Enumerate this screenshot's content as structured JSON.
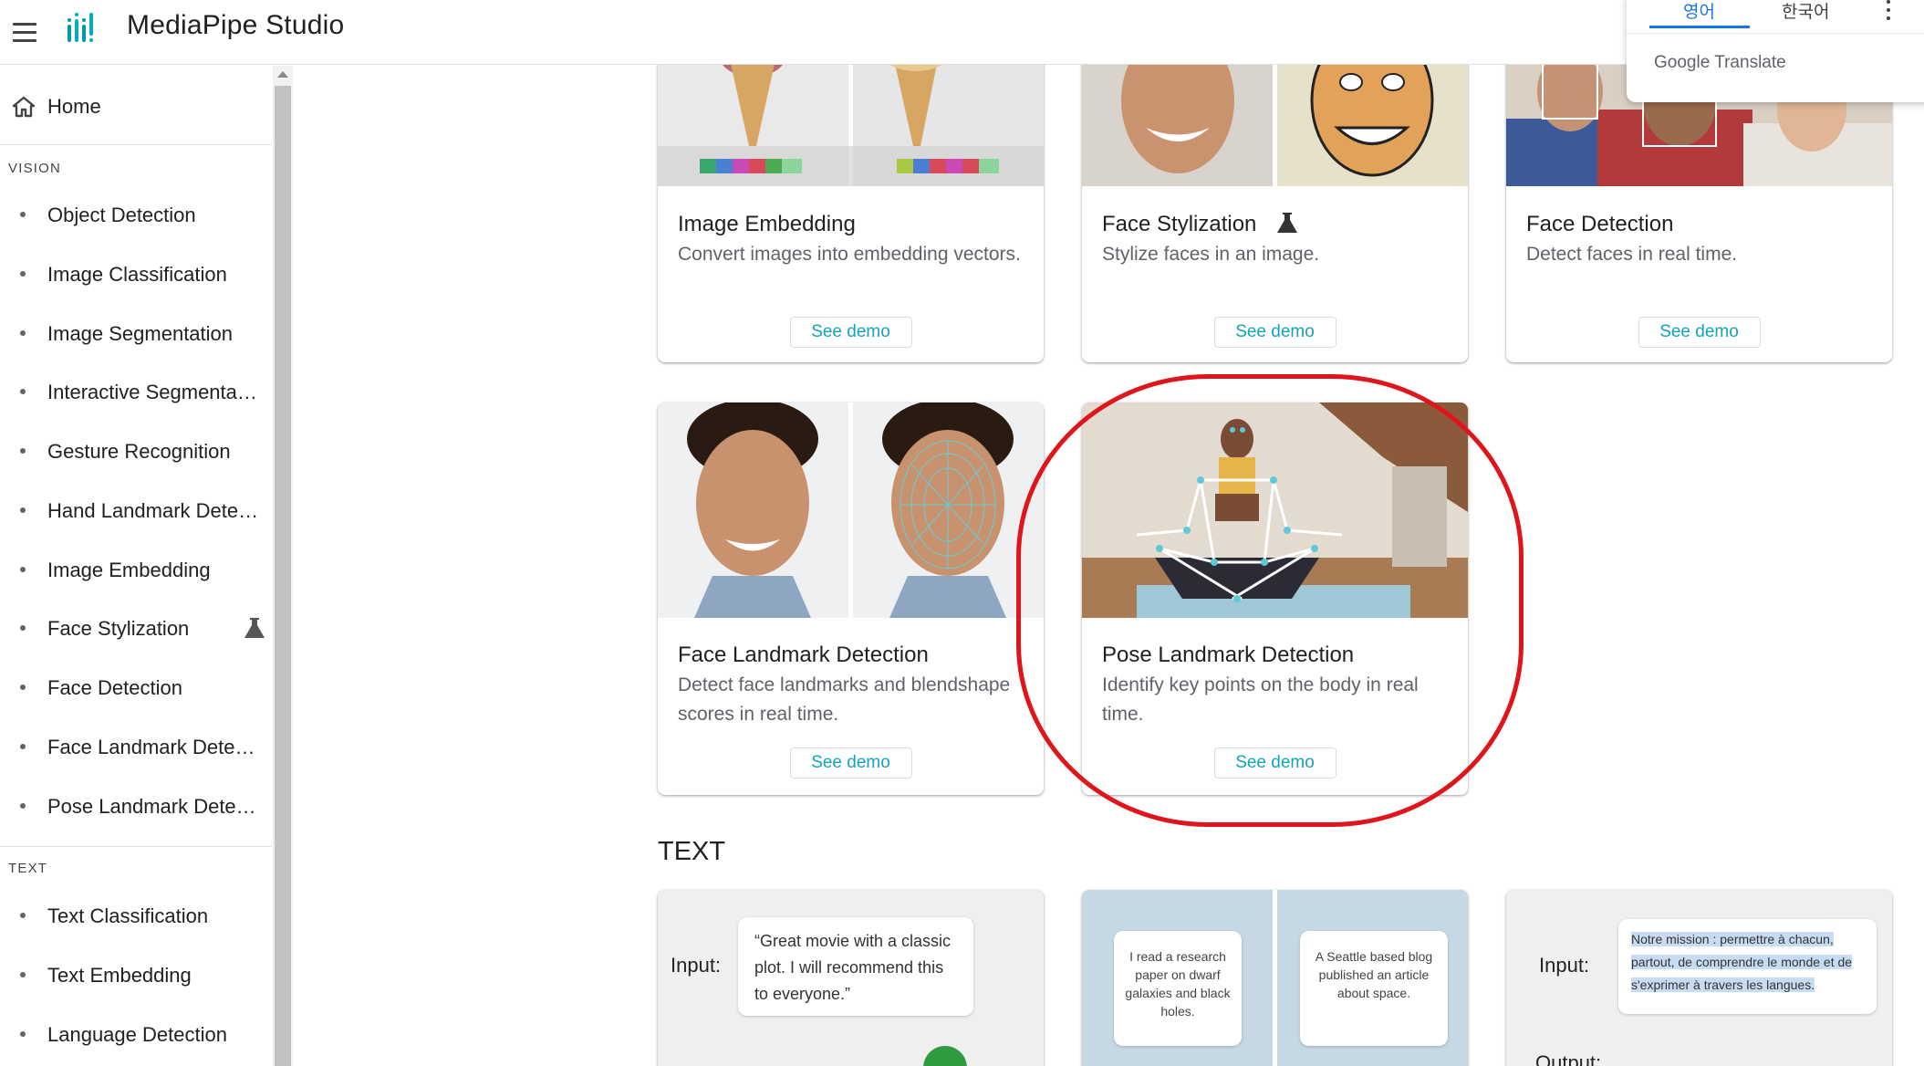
{
  "app": {
    "title": "MediaPipe Studio"
  },
  "translate_popup": {
    "tab_source": "영어",
    "tab_target": "한국어",
    "brand": "Google Translate"
  },
  "sidebar": {
    "home_label": "Home",
    "vision_section": "VISION",
    "text_section": "TEXT",
    "vision_items": [
      {
        "label": "Object Detection"
      },
      {
        "label": "Image Classification"
      },
      {
        "label": "Image Segmentation"
      },
      {
        "label": "Interactive Segmentati..."
      },
      {
        "label": "Gesture Recognition"
      },
      {
        "label": "Hand Landmark Detec..."
      },
      {
        "label": "Image Embedding"
      },
      {
        "label": "Face Stylization"
      },
      {
        "label": "Face Detection"
      },
      {
        "label": "Face Landmark Detect..."
      },
      {
        "label": "Pose Landmark Detec..."
      }
    ],
    "text_items": [
      {
        "label": "Text Classification"
      },
      {
        "label": "Text Embedding"
      },
      {
        "label": "Language Detection"
      }
    ]
  },
  "cards": {
    "image_embedding": {
      "title": "Image Embedding",
      "desc": "Convert images into embedding vectors.",
      "button": "See demo"
    },
    "face_stylization": {
      "title": "Face Stylization",
      "desc": "Stylize faces in an image.",
      "button": "See demo"
    },
    "face_detection": {
      "title": "Face Detection",
      "desc": "Detect faces in real time.",
      "button": "See demo"
    },
    "face_landmark": {
      "title": "Face Landmark Detection",
      "desc": "Detect face landmarks and blendshape scores in real time.",
      "button": "See demo"
    },
    "pose_landmark": {
      "title": "Pose Landmark Detection",
      "desc": "Identify key points on the body in real time.",
      "button": "See demo"
    }
  },
  "text_section": {
    "heading": "TEXT",
    "classification_preview": {
      "input_label": "Input:",
      "quote": "“Great movie with a classic plot. I will recommend this to everyone.”"
    },
    "embedding_preview": {
      "left_text": "I read a research paper on dwarf galaxies and black holes.",
      "right_text": "A Seattle based blog published an article about space."
    },
    "language_preview": {
      "input_label": "Input:",
      "quote": "Notre mission : permettre à chacun, partout, de comprendre le monde et de s'exprimer à travers les langues.",
      "output_label": "Output:"
    }
  },
  "colors": {
    "accent": "#12a4b7",
    "highlight_ring": "#e0151c",
    "translate_blue": "#1a73e8"
  }
}
